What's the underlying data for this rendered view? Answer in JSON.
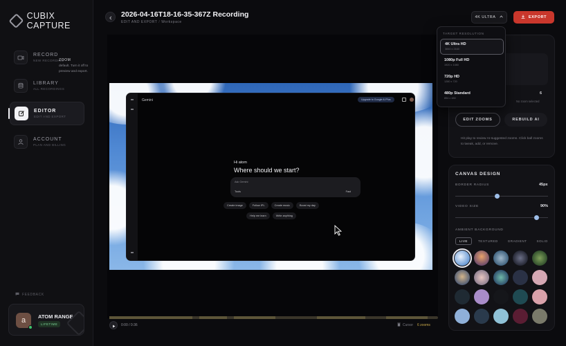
{
  "brand": {
    "name": "CUBIX CAPTURE"
  },
  "nav": [
    {
      "title": "RECORD",
      "sub": "NEW RECORDING",
      "icon": "camera-icon"
    },
    {
      "title": "LIBRARY",
      "sub": "ALL RECORDINGS",
      "icon": "database-icon"
    },
    {
      "title": "EDITOR",
      "sub": "EDIT AND EXPORT",
      "icon": "edit-icon",
      "active": true
    },
    {
      "title": "ACCOUNT",
      "sub": "PLAN AND BILLING",
      "icon": "user-icon"
    }
  ],
  "feedback": "FEEDBACK",
  "user": {
    "initial": "a",
    "name": "ATOM RANGE",
    "badge": "LIFETIME"
  },
  "header": {
    "title": "2026-04-16T18-16-35-367Z Recording",
    "subtitle": "EDIT AND EXPORT",
    "subtitle_extra": "Workspace",
    "resolution_label": "4K ULTRA",
    "export_label": "EXPORT"
  },
  "dropdown": {
    "heading": "TARGET RESOLUTION",
    "options": [
      {
        "name": "4K Ultra HD",
        "dims": "3840 x 2160",
        "selected": true
      },
      {
        "name": "1080p Full HD",
        "dims": "1920 x 1080"
      },
      {
        "name": "720p HD",
        "dims": "1280 x 720"
      },
      {
        "name": "480p Standard",
        "dims": "854 x 480"
      }
    ]
  },
  "preview": {
    "app_name": "Gemini",
    "upgrade": "Upgrade to Google AI Plus",
    "greeting": "Hi atom",
    "question": "Where should we start?",
    "ask_placeholder": "Ask Gemini",
    "tools": "Tools",
    "fast": "Fast",
    "chips_row1": [
      "Create image",
      "Follow IPL",
      "Create music",
      "Boost my day"
    ],
    "chips_row2": [
      "Help me learn",
      "Write anything"
    ]
  },
  "playback": {
    "time": "0:00 / 0:36",
    "cursor_label": "Cursor",
    "zoom_count": "6 zooms",
    "progress": 0.0
  },
  "zoom_panel": {
    "info_title": "ZOOM",
    "info_text": "default. Turn it off to preview and export.",
    "count": "6",
    "no_selection": "No zoom selected",
    "edit_label": "EDIT ZOOMS",
    "rebuild_label": "REBUILD AI",
    "hint": "Hit play to review AI-suggested zooms. Click ball zooms to tweak, add, or remove."
  },
  "canvas": {
    "title": "CANVAS DESIGN",
    "radius_label": "BORDER RADIUS",
    "radius_value": "45px",
    "radius_level": 0.45,
    "video_size_label": "VIDEO SIZE",
    "video_size_value": "90%",
    "video_size_level": 0.9,
    "ambient_label": "AMBIENT BACKGROUND",
    "tabs": [
      "LIVE",
      "TEXTURED",
      "GRADIENT",
      "SOLID"
    ],
    "active_tab": "LIVE"
  },
  "colors": {
    "accent": "#c9372c",
    "slider_knob": "#9dbde8",
    "zoom_count": "#c9a94a"
  }
}
